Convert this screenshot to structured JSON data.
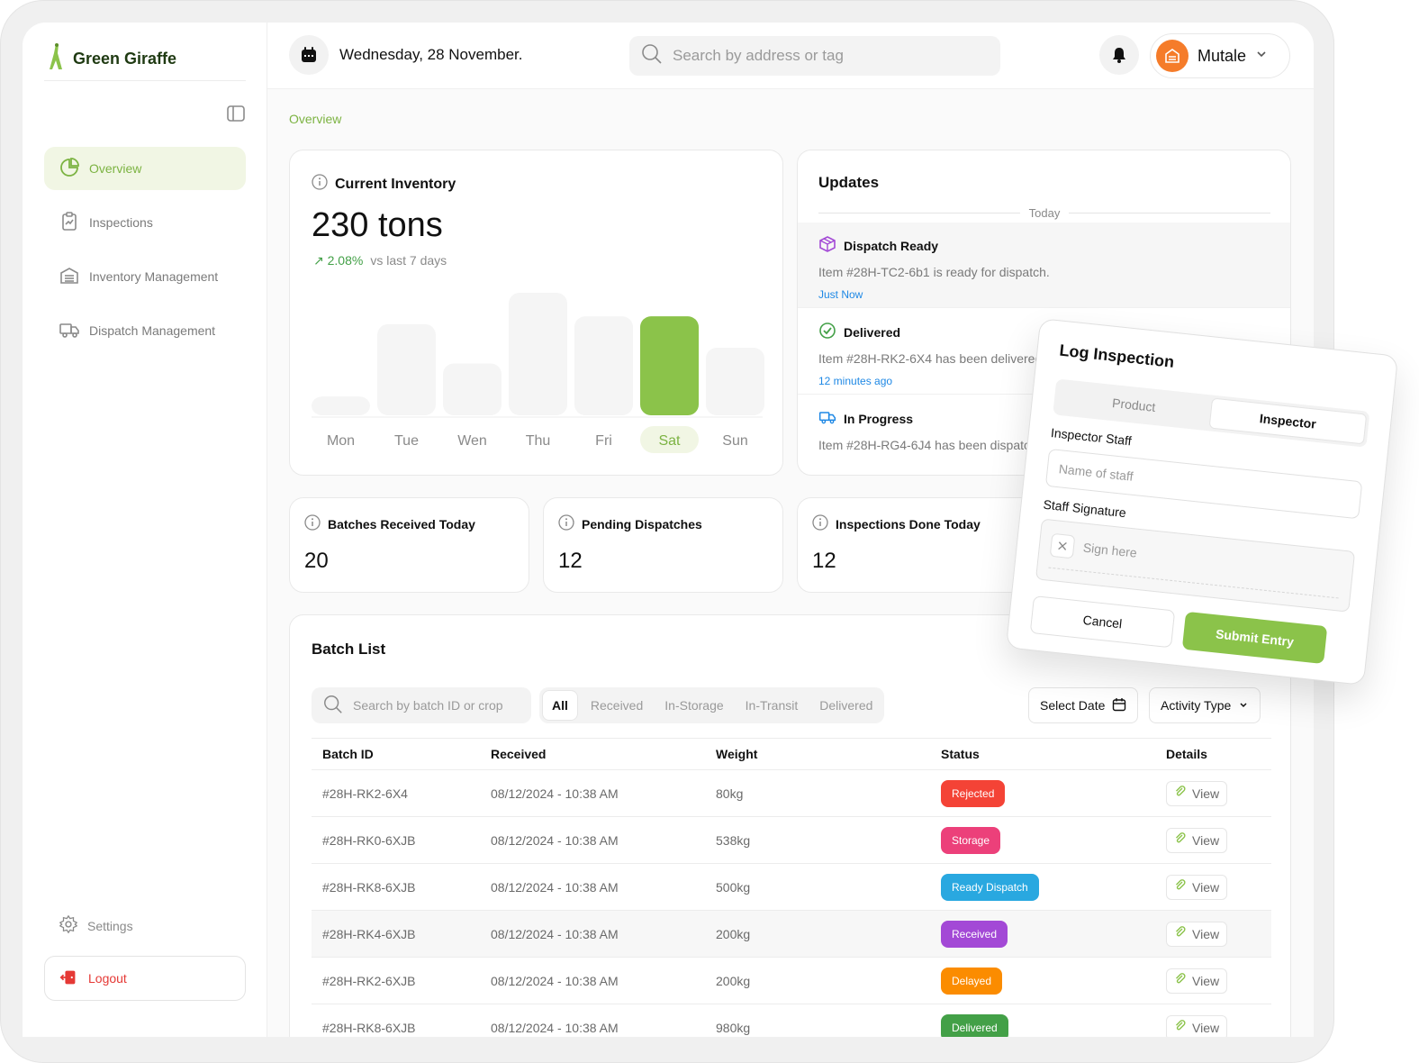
{
  "app": {
    "name": "Green Giraffe"
  },
  "sidebar": {
    "items": [
      {
        "label": "Overview",
        "icon": "pie-chart-icon"
      },
      {
        "label": "Inspections",
        "icon": "clipboard-icon"
      },
      {
        "label": "Inventory Management",
        "icon": "warehouse-icon"
      },
      {
        "label": "Dispatch Management",
        "icon": "truck-icon"
      }
    ],
    "active": "Overview",
    "settings_label": "Settings",
    "logout_label": "Logout"
  },
  "header": {
    "date": "Wednesday, 28 November.",
    "search_placeholder": "Search by address or tag",
    "user_name": "Mutale"
  },
  "breadcrumb": "Overview",
  "inventory": {
    "title": "Current Inventory",
    "value": "230 tons",
    "change": "2.08%",
    "change_label": "vs last 7 days"
  },
  "chart_data": {
    "type": "bar",
    "categories": [
      "Mon",
      "Tue",
      "Wen",
      "Thu",
      "Fri",
      "Sat",
      "Sun"
    ],
    "values": [
      12,
      58,
      33,
      78,
      63,
      63,
      43
    ],
    "highlight": "Sat",
    "colors": {
      "bar": "#f5f5f5",
      "highlight": "#8bc34a"
    }
  },
  "updates": {
    "title": "Updates",
    "group_label": "Today",
    "items": [
      {
        "title": "Dispatch Ready",
        "desc": "Item #28H-TC2-6b1 is ready for dispatch.",
        "time": "Just Now",
        "icon": "package-icon"
      },
      {
        "title": "Delivered",
        "desc": "Item #28H-RK2-6X4 has been delivered.",
        "time": "12 minutes ago",
        "icon": "check-circle-icon"
      },
      {
        "title": "In Progress",
        "desc": "Item #28H-RG4-6J4 has been dispatched.",
        "time": "",
        "icon": "truck-icon"
      }
    ]
  },
  "stats": [
    {
      "title": "Batches Received Today",
      "value": "20"
    },
    {
      "title": "Pending Dispatches",
      "value": "12"
    },
    {
      "title": "Inspections Done Today",
      "value": "12"
    }
  ],
  "batch": {
    "title": "Batch List",
    "search_placeholder": "Search by batch ID or crop",
    "tabs": [
      "All",
      "Received",
      "In-Storage",
      "In-Transit",
      "Delivered"
    ],
    "active_tab": "All",
    "select_date": "Select Date",
    "activity_type": "Activity Type",
    "columns": [
      "Batch ID",
      "Received",
      "Weight",
      "Status",
      "Details"
    ],
    "rows": [
      {
        "id": "#28H-RK2-6X4",
        "received": "08/12/2024 - 10:38 AM",
        "weight": "80kg",
        "status": "Rejected",
        "color": "#f44336",
        "details": "View"
      },
      {
        "id": "#28H-RK0-6XJB",
        "received": "08/12/2024 - 10:38 AM",
        "weight": "538kg",
        "status": "Storage",
        "color": "#ec407a",
        "details": "View"
      },
      {
        "id": "#28H-RK8-6XJB",
        "received": "08/12/2024 - 10:38 AM",
        "weight": "500kg",
        "status": "Ready Dispatch",
        "color": "#29a8e0",
        "details": "View"
      },
      {
        "id": "#28H-RK4-6XJB",
        "received": "08/12/2024 - 10:38 AM",
        "weight": "200kg",
        "status": "Received",
        "color": "#a349d6",
        "details": "View"
      },
      {
        "id": "#28H-RK2-6XJB",
        "received": "08/12/2024 - 10:38 AM",
        "weight": "200kg",
        "status": "Delayed",
        "color": "#fb8c00",
        "details": "View"
      },
      {
        "id": "#28H-RK8-6XJB",
        "received": "08/12/2024 - 10:38 AM",
        "weight": "980kg",
        "status": "Delivered",
        "color": "#43a047",
        "details": "View"
      }
    ]
  },
  "modal": {
    "title": "Log Inspection",
    "tabs": [
      "Product",
      "Inspector"
    ],
    "active_tab": "Inspector",
    "staff_label": "Inspector Staff",
    "staff_placeholder": "Name of staff",
    "signature_label": "Staff Signature",
    "signature_placeholder": "Sign here",
    "cancel": "Cancel",
    "submit": "Submit Entry"
  }
}
